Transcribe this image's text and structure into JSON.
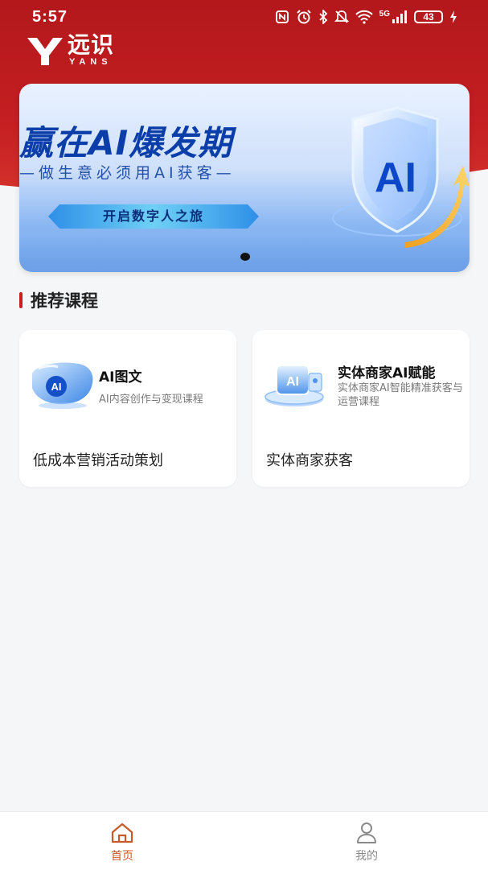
{
  "status_bar": {
    "time": "5:57",
    "network": "5G",
    "battery": "43"
  },
  "header": {
    "logo_cn": "远识",
    "logo_en": "YANS"
  },
  "banner": {
    "title": "赢在AI爆发期",
    "subtitle": "—做生意必须用AI获客—",
    "button_label": "开启数字人之旅",
    "badge_text": "AI",
    "slide_count": 1,
    "active_slide": 1
  },
  "section": {
    "title": "推荐课程"
  },
  "courses": [
    {
      "badge": "AI",
      "title": "AI图文",
      "description": "AI内容创作与变现课程",
      "caption": "低成本营销活动策划"
    },
    {
      "badge": "AI",
      "title": "实体商家AI赋能",
      "description": "实体商家AI智能精准获客与运营课程",
      "caption": "实体商家获客"
    }
  ],
  "bottom_nav": {
    "items": [
      {
        "label": "首页",
        "icon": "home-icon",
        "active": true
      },
      {
        "label": "我的",
        "icon": "user-icon",
        "active": false
      }
    ]
  },
  "colors": {
    "brand_red": "#c51f22",
    "active_nav": "#c85a2a",
    "banner_blue": "#0b3ea9"
  }
}
